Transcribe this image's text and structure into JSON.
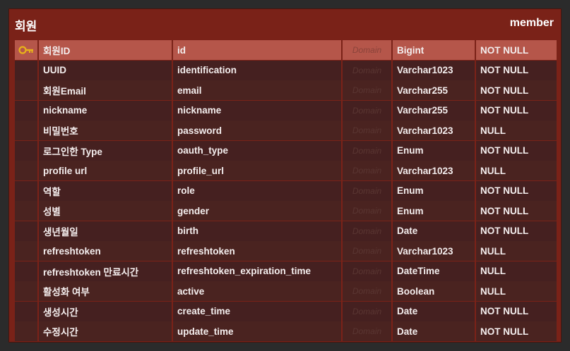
{
  "entity": {
    "logical_name": "회원",
    "physical_name": "member",
    "domain_placeholder": "Domain",
    "columns": [
      {
        "logical": "회원ID",
        "physical": "id",
        "type": "Bigint",
        "nullable": "NOT NULL",
        "primary_key": true
      },
      {
        "logical": "UUID",
        "physical": "identification",
        "type": "Varchar1023",
        "nullable": "NOT NULL"
      },
      {
        "logical": "회원Email",
        "physical": "email",
        "type": "Varchar255",
        "nullable": "NOT NULL"
      },
      {
        "logical": "nickname",
        "physical": "nickname",
        "type": "Varchar255",
        "nullable": "NOT NULL"
      },
      {
        "logical": "비밀번호",
        "physical": "password",
        "type": "Varchar1023",
        "nullable": "NULL"
      },
      {
        "logical": "로그인한 Type",
        "physical": "oauth_type",
        "type": "Enum",
        "nullable": "NOT NULL"
      },
      {
        "logical": "profile url",
        "physical": "profile_url",
        "type": "Varchar1023",
        "nullable": "NULL"
      },
      {
        "logical": "역할",
        "physical": "role",
        "type": "Enum",
        "nullable": "NOT NULL"
      },
      {
        "logical": "성별",
        "physical": "gender",
        "type": "Enum",
        "nullable": "NOT NULL"
      },
      {
        "logical": "생년월일",
        "physical": "birth",
        "type": "Date",
        "nullable": "NOT NULL"
      },
      {
        "logical": "refreshtoken",
        "physical": "refreshtoken",
        "type": "Varchar1023",
        "nullable": "NULL"
      },
      {
        "logical": "refreshtoken 만료시간",
        "physical": "refreshtoken_expiration_time",
        "type": "DateTime",
        "nullable": "NULL"
      },
      {
        "logical": "활성화 여부",
        "physical": "active",
        "type": "Boolean",
        "nullable": "NULL"
      },
      {
        "logical": "생성시간",
        "physical": "create_time",
        "type": "Date",
        "nullable": "NOT NULL"
      },
      {
        "logical": "수정시간",
        "physical": "update_time",
        "type": "Date",
        "nullable": "NOT NULL"
      }
    ]
  },
  "colors": {
    "entity_background": "#7a2218",
    "primary_key_row": "#b5564a",
    "row": "#4a2320",
    "key_icon": "#e8b21a"
  },
  "icons": {
    "primary_key": "key-icon"
  }
}
